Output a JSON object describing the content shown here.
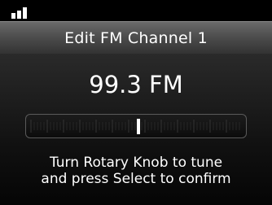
{
  "status": {
    "signal_icon": "signal-bars-icon",
    "signal_level": 3
  },
  "header": {
    "title": "Edit FM Channel 1"
  },
  "tuner": {
    "frequency_text": "99.3 FM",
    "position": 0.51
  },
  "instructions": {
    "line1": "Turn Rotary Knob to tune",
    "line2": "and press Select to confirm"
  }
}
